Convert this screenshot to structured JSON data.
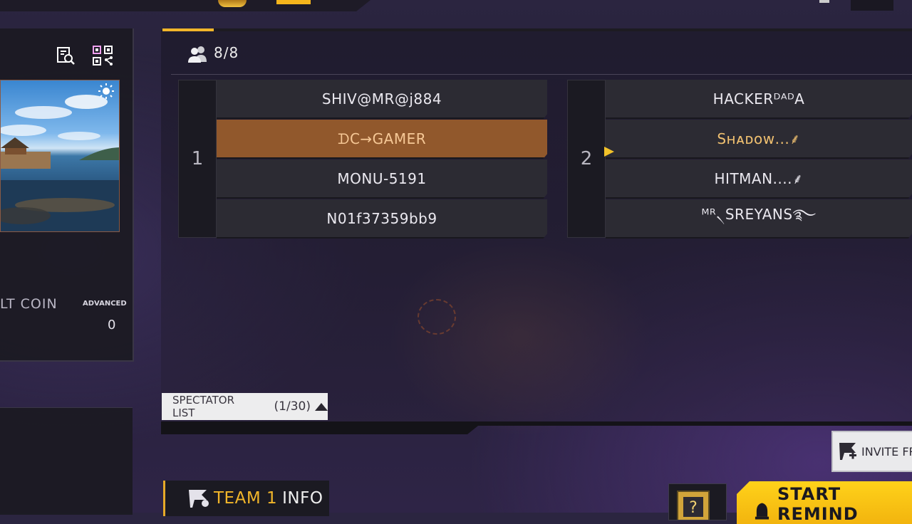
{
  "left_panel": {
    "label_partial": "LT COIN",
    "advanced_label": "ADVANCED",
    "coin_value": "0"
  },
  "lobby": {
    "player_count": "8/8",
    "teams": [
      {
        "number": "1",
        "players": [
          "SHIV@MR@j884",
          "ᗪC→GAMER",
          "MONU-5191",
          "N01f37359bb9"
        ],
        "selected_index": 1
      },
      {
        "number": "2",
        "players": [
          "HACKERᴰᴬᴰA",
          "Sʜᴀᴅᴏᴡ...⸙",
          "HITMAN....⸙",
          "ᴹᴿ৲SREYANS࿐"
        ]
      }
    ]
  },
  "spectator": {
    "label": "SPECTATOR LIST",
    "count": "(1/30)"
  },
  "invite": {
    "label": "INVITE FR"
  },
  "team_info": {
    "prefix": "TEAM 1",
    "suffix": "INFO"
  },
  "start_button": {
    "label": "START REMIND"
  },
  "colors": {
    "accent_gold": "#f2b62a",
    "selected_slot": "#91582c",
    "start_yellow": "#ffd21a"
  }
}
